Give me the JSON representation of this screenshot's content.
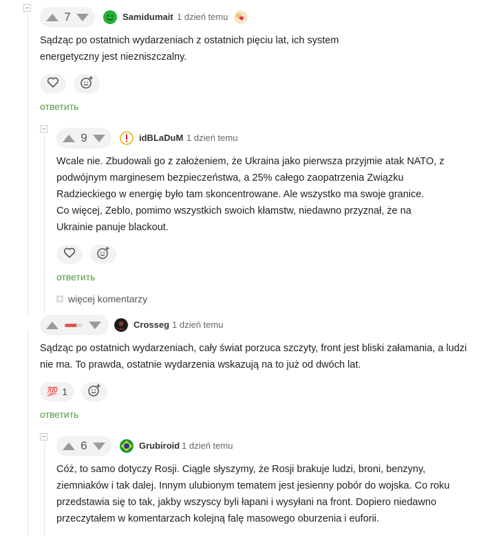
{
  "reply_label": "ответить",
  "more_comments_label": "więcej komentarzy",
  "comments": [
    {
      "score": "7",
      "author": "Samidumait",
      "time": "1 dzień temu",
      "paragraphs": [
        "Sądząc po ostatnich wydarzeniach z ostatnich pięciu lat, ich system energetyczny jest niezniszczalny."
      ]
    },
    {
      "score": "9",
      "author": "idBLaDuM",
      "time": "1 dzień temu",
      "paragraphs": [
        "Wcale nie. Zbudowali go z założeniem, że Ukraina jako pierwsza przyjmie atak NATO, z podwójnym marginesem bezpieczeństwa, a 25% całego zaopatrzenia Związku Radzieckiego w energię było tam skoncentrowane. Ale wszystko ma swoje granice.",
        "Co więcej, Zeblo, pomimo wszystkich swoich kłamstw, niedawno przyznał, że na Ukrainie panuje blackout."
      ]
    },
    {
      "score": "",
      "author": "Crosseg",
      "time": "1 dzień temu",
      "paragraphs": [
        "Sądząc po ostatnich wydarzeniach, cały świat porzuca szczyty, front jest bliski załamania, a ludzi nie ma. To prawda, ostatnie wydarzenia wskazują na to już od dwóch lat."
      ],
      "reaction_emoji": "💯",
      "reaction_count": "1"
    },
    {
      "score": "6",
      "author": "Grubiroid",
      "time": "1 dzień temu",
      "paragraphs": [
        "Cóż, to samo dotyczy Rosji. Ciągle słyszymy, że Rosji brakuje ludzi, broni, benzyny, ziemniaków i tak dalej. Innym ulubionym tematem jest jesienny pobór do wojska. Co roku przedstawia się to tak, jakby wszyscy byli łapani i wysyłani na front. Dopiero niedawno przeczytałem w komentarzach kolejną falę masowego oburzenia i euforii."
      ]
    }
  ],
  "colors": {
    "accent_green": "#4e9a3a",
    "vote_bg": "#f2f2f2",
    "negative_bar": "#e05555"
  }
}
